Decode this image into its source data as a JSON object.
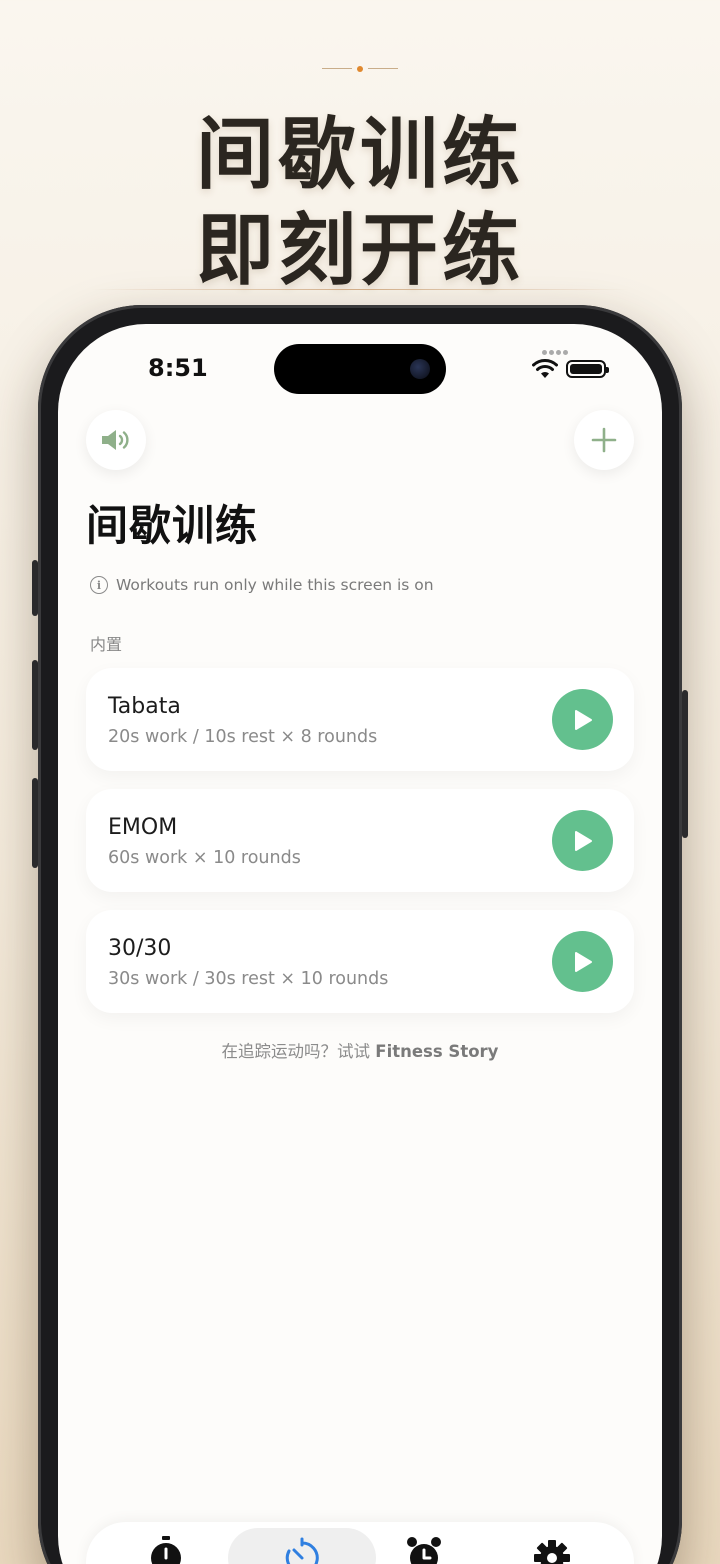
{
  "promo_header": {
    "line1": "间歇训练",
    "line2": "即刻开练"
  },
  "status_bar": {
    "time": "8:51"
  },
  "icons": {
    "sound": "speaker-icon",
    "add": "plus-icon",
    "info": "info-icon",
    "play": "play-icon"
  },
  "colors": {
    "accent_green": "#63c08e",
    "icon_green": "#8fb08a",
    "deco_orange": "#e0892f"
  },
  "screen": {
    "title": "间歇训练",
    "notice": "Workouts run only while this screen is on",
    "section_label": "内置",
    "workouts": [
      {
        "name": "Tabata",
        "description": "20s work / 10s rest × 8 rounds"
      },
      {
        "name": "EMOM",
        "description": "60s work × 10 rounds"
      },
      {
        "name": "30/30",
        "description": "30s work / 30s rest × 10 rounds"
      }
    ],
    "promo_text": "在追踪运动吗？试试",
    "promo_app": "Fitness Story"
  },
  "tabbar": {
    "tabs": [
      {
        "icon": "stopwatch-icon"
      },
      {
        "icon": "timer-icon",
        "active": true
      },
      {
        "icon": "alarm-icon"
      },
      {
        "icon": "gear-icon"
      }
    ]
  }
}
